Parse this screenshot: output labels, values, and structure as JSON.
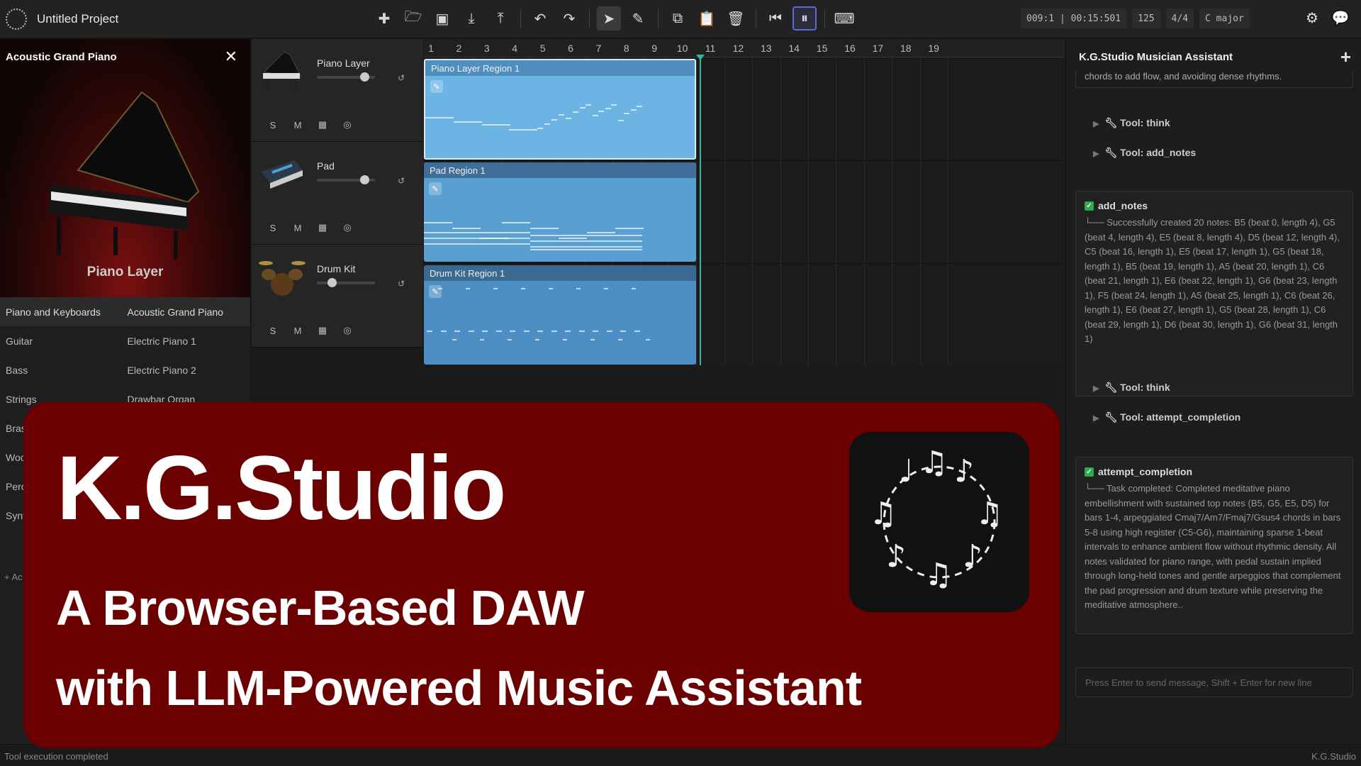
{
  "app": {
    "project_title": "Untitled Project",
    "position": "009:1 | 00:15:501",
    "tempo": "125",
    "time_signature": "4/4",
    "key": "C major"
  },
  "instrument_panel": {
    "title": "Acoustic Grand Piano",
    "caption": "Piano Layer",
    "categories": [
      "Piano and Keyboards",
      "Guitar",
      "Bass",
      "Strings",
      "Bras",
      "Woo",
      "Perc",
      "Synt"
    ],
    "instruments": [
      "Acoustic Grand Piano",
      "Electric Piano 1",
      "Electric Piano 2",
      "Drawbar Organ"
    ],
    "add_track": "+ Ac"
  },
  "tracks": [
    {
      "name": "Piano Layer",
      "region": "Piano Layer Region 1",
      "volume": 0.82
    },
    {
      "name": "Pad",
      "region": "Pad Region 1",
      "volume": 0.82
    },
    {
      "name": "Drum Kit",
      "region": "Drum Kit Region 1",
      "volume": 0.25
    }
  ],
  "track_buttons": {
    "solo": "S",
    "mute": "M"
  },
  "ruler": [
    "1",
    "2",
    "3",
    "4",
    "5",
    "6",
    "7",
    "8",
    "9",
    "10",
    "11",
    "12",
    "13",
    "14",
    "15",
    "16",
    "17",
    "18",
    "19"
  ],
  "assistant": {
    "title": "K.G.Studio Musician Assistant",
    "fragment": "chords to add flow, and avoiding dense rhythms.",
    "tool_think_1": "Tool: think",
    "tool_add_notes": "Tool: add_notes",
    "card1_title": "add_notes",
    "card1_body": "└── Successfully created 20 notes: B5 (beat 0, length 4), G5 (beat 4, length 4), E5 (beat 8, length 4), D5 (beat 12, length 4), C5 (beat 16, length 1), E5 (beat 17, length 1), G5 (beat 18, length 1), B5 (beat 19, length 1), A5 (beat 20, length 1), C6 (beat 21, length 1), E6 (beat 22, length 1), G6 (beat 23, length 1), F5 (beat 24, length 1), A5 (beat 25, length 1), C6 (beat 26, length 1), E6 (beat 27, length 1), G5 (beat 28, length 1), C6 (beat 29, length 1), D6 (beat 30, length 1), G6 (beat 31, length 1)",
    "tool_think_2": "Tool: think",
    "tool_attempt": "Tool: attempt_completion",
    "card2_title": "attempt_completion",
    "card2_body": "└── Task completed: Completed meditative piano embellishment with sustained top notes (B5, G5, E5, D5) for bars 1-4, arpeggiated Cmaj7/Am7/Fmaj7/Gsus4 chords in bars 5-8 using high register (C5-G6), maintaining sparse 1-beat intervals to enhance ambient flow without rhythmic density. All notes validated for piano range, with pedal sustain implied through long-held tones and gentle arpeggios that complement the pad progression and drum texture while preserving the meditative atmosphere..",
    "input_placeholder": "Press Enter to send message, Shift + Enter for new line"
  },
  "footer": {
    "status": "Tool execution completed",
    "brand": "K.G.Studio"
  },
  "banner": {
    "title": "K.G.Studio",
    "subtitle1": "A Browser-Based DAW",
    "subtitle2": "with LLM-Powered Music Assistant"
  },
  "colors": {
    "banner": "#6b0000",
    "region_piano": "#6cb4e4",
    "region_pad": "#5a9fd1",
    "region_drum": "#4d8fc4",
    "playhead": "#2fb5a0"
  }
}
